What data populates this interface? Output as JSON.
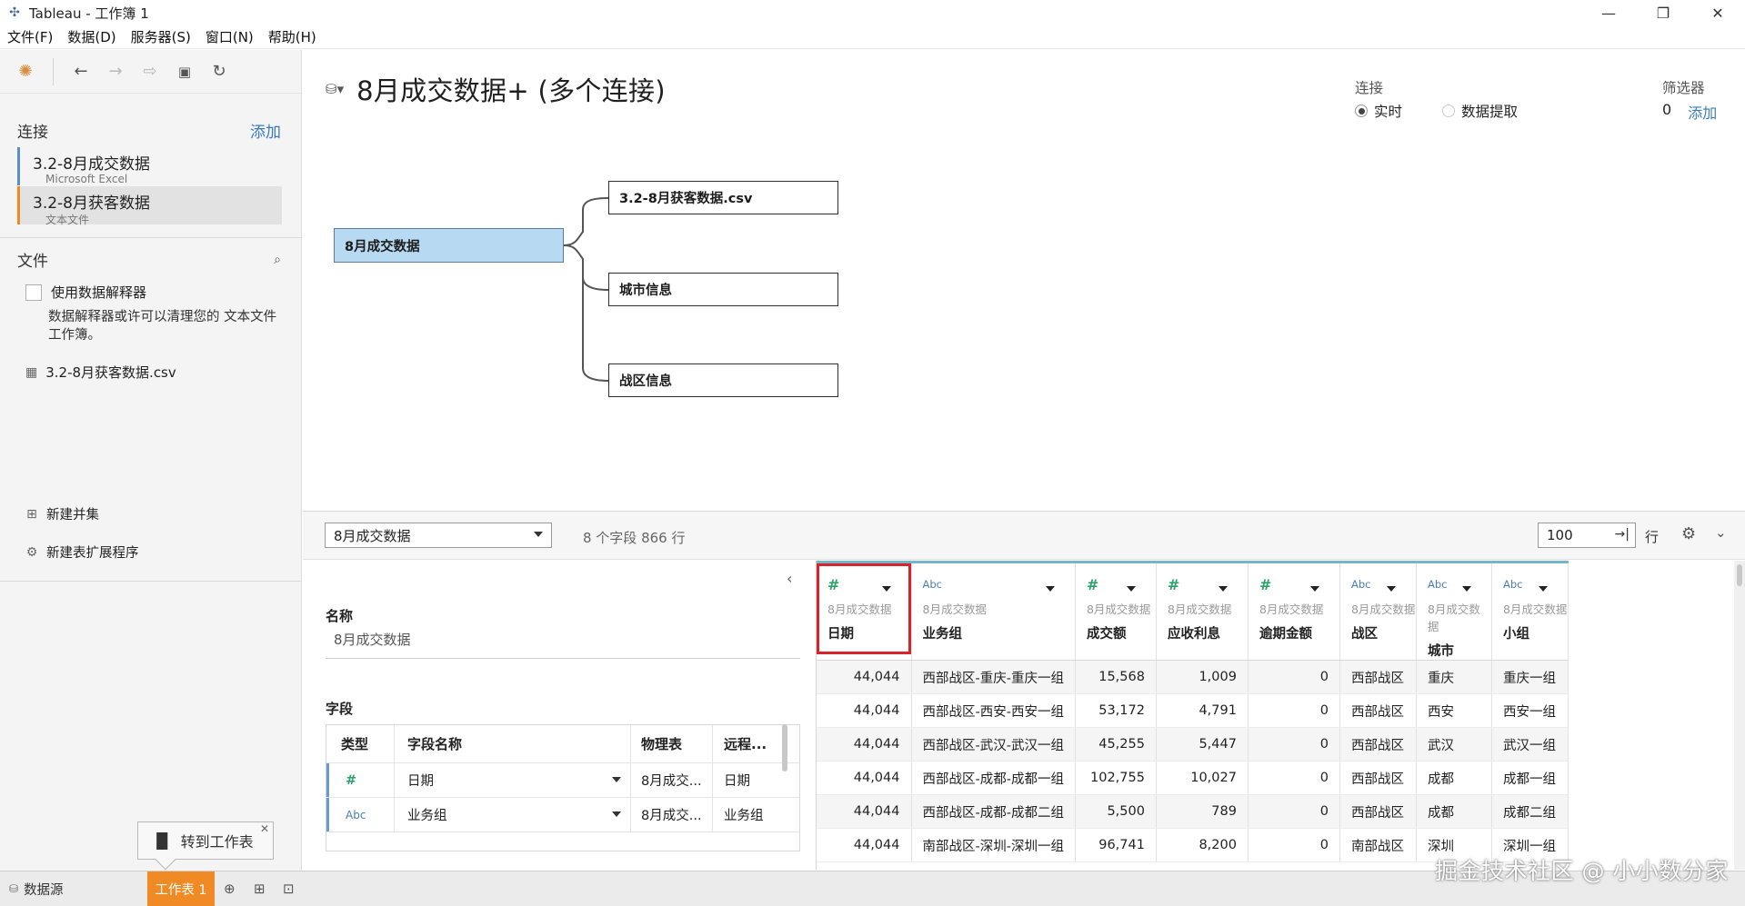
{
  "window": {
    "title": "Tableau - 工作簿 1"
  },
  "menu": [
    "文件(F)",
    "数据(D)",
    "服务器(S)",
    "窗口(N)",
    "帮助(H)"
  ],
  "sidebar": {
    "connections_title": "连接",
    "add_label": "添加",
    "connections": [
      {
        "name": "3.2-8月成交数据",
        "type": "Microsoft Excel"
      },
      {
        "name": "3.2-8月获客数据",
        "type": "文本文件"
      }
    ],
    "files_title": "文件",
    "interpreter_label": "使用数据解释器",
    "interpreter_desc": "数据解释器或许可以清理您的 文本文件 工作簿。",
    "file_item": "3.2-8月获客数据.csv",
    "new_union": "新建并集",
    "new_extension": "新建表扩展程序"
  },
  "datasource": {
    "title": "8月成交数据+ (多个连接)",
    "connection_header": "连接",
    "mode_live": "实时",
    "mode_extract": "数据提取",
    "filters_header": "筛选器",
    "filters_count": "0",
    "filters_add": "添加"
  },
  "canvas": {
    "root_table": "8月成交数据",
    "joined_tables": [
      "3.2-8月获客数据.csv",
      "城市信息",
      "战区信息"
    ]
  },
  "grid_toolbar": {
    "selected_table": "8月成交数据",
    "fields_info": "8 个字段 866 行",
    "rows_value": "100",
    "rows_label": "行"
  },
  "metadata": {
    "name_label": "名称",
    "name_value": "8月成交数据",
    "fields_label": "字段",
    "headers": [
      "类型",
      "字段名称",
      "物理表",
      "远程..."
    ],
    "rows": [
      {
        "type": "#",
        "name": "日期",
        "table": "8月成交...",
        "remote": "日期"
      },
      {
        "type": "Abc",
        "name": "业务组",
        "table": "8月成交...",
        "remote": "业务组"
      }
    ]
  },
  "grid": {
    "columns": [
      {
        "type": "#",
        "source": "8月成交数据",
        "name": "日期"
      },
      {
        "type": "Abc",
        "source": "8月成交数据",
        "name": "业务组"
      },
      {
        "type": "#",
        "source": "8月成交数据",
        "name": "成交额"
      },
      {
        "type": "#",
        "source": "8月成交数据",
        "name": "应收利息"
      },
      {
        "type": "#",
        "source": "8月成交数据",
        "name": "逾期金额"
      },
      {
        "type": "Abc",
        "source": "8月成交数据",
        "name": "战区"
      },
      {
        "type": "Abc",
        "source": "8月成交数据",
        "name": "城市"
      },
      {
        "type": "Abc",
        "source": "8月成交数据",
        "name": "小组"
      }
    ],
    "rows": [
      [
        "44,044",
        "西部战区-重庆-重庆一组",
        "15,568",
        "1,009",
        "0",
        "西部战区",
        "重庆",
        "重庆一组"
      ],
      [
        "44,044",
        "西部战区-西安-西安一组",
        "53,172",
        "4,791",
        "0",
        "西部战区",
        "西安",
        "西安一组"
      ],
      [
        "44,044",
        "西部战区-武汉-武汉一组",
        "45,255",
        "5,447",
        "0",
        "西部战区",
        "武汉",
        "武汉一组"
      ],
      [
        "44,044",
        "西部战区-成都-成都一组",
        "102,755",
        "10,027",
        "0",
        "西部战区",
        "成都",
        "成都一组"
      ],
      [
        "44,044",
        "西部战区-成都-成都二组",
        "5,500",
        "789",
        "0",
        "西部战区",
        "成都",
        "成都二组"
      ],
      [
        "44,044",
        "南部战区-深圳-深圳一组",
        "96,741",
        "8,200",
        "0",
        "南部战区",
        "深圳",
        "深圳一组"
      ]
    ]
  },
  "tooltip": {
    "label": "转到工作表"
  },
  "tabs": {
    "datasource": "数据源",
    "sheet1": "工作表 1"
  },
  "watermark": "掘金技术社区 @ 小小数分家",
  "colors": {
    "accent_orange": "#f08a24",
    "root_table_fill": "#b7d9f1",
    "highlight_red": "#d9232b",
    "link_blue": "#3a7bbd",
    "number_green": "#29a36a"
  }
}
